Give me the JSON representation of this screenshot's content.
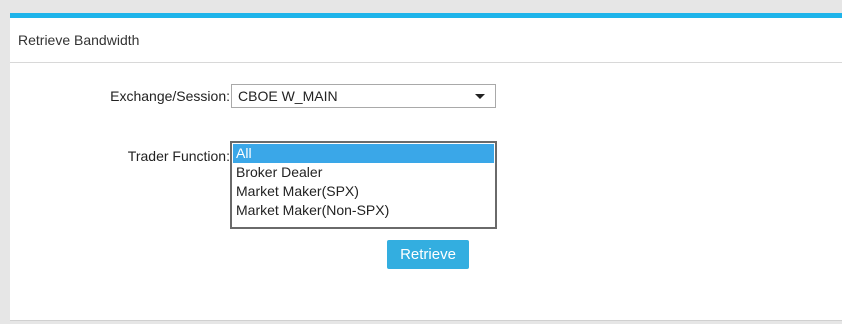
{
  "panel": {
    "title": "Retrieve Bandwidth"
  },
  "form": {
    "exchange_label": "Exchange/Session:",
    "exchange_value": "CBOE W_MAIN",
    "trader_label": "Trader Function:",
    "trader_options": [
      {
        "label": "All",
        "selected": true
      },
      {
        "label": "Broker Dealer",
        "selected": false
      },
      {
        "label": "Market Maker(SPX)",
        "selected": false
      },
      {
        "label": "Market Maker(Non-SPX)",
        "selected": false
      }
    ],
    "retrieve_label": "Retrieve"
  },
  "icons": {
    "dropdown": "chevron-down-icon"
  },
  "colors": {
    "accent": "#1eb4ea",
    "button": "#33aee0",
    "selection": "#3aa7e8"
  }
}
